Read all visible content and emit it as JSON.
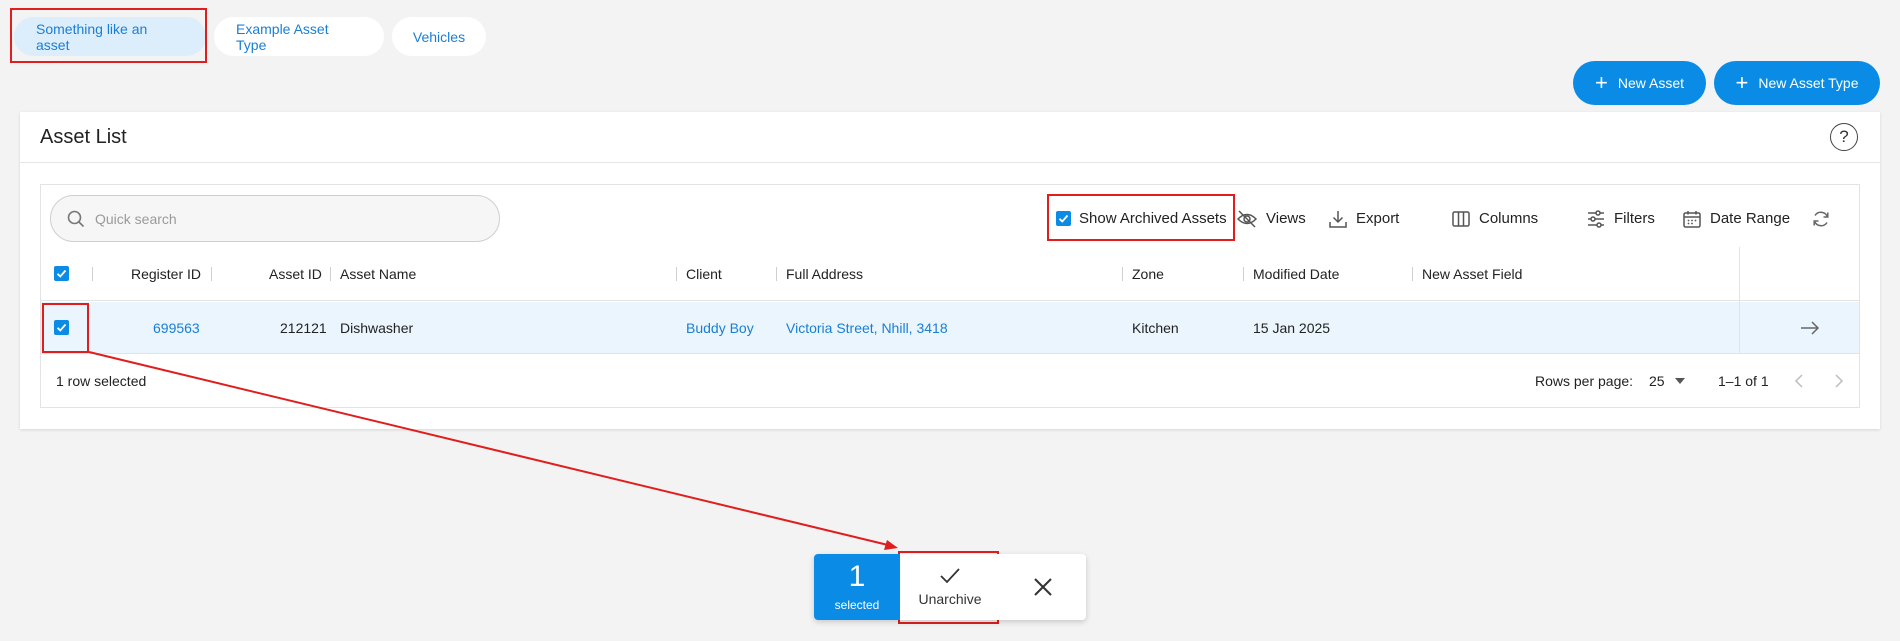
{
  "tabs": [
    {
      "label": "Something like an asset",
      "active": true
    },
    {
      "label": "Example Asset Type",
      "active": false
    },
    {
      "label": "Vehicles",
      "active": false
    }
  ],
  "actions": {
    "new_asset": "New Asset",
    "new_asset_type": "New Asset Type"
  },
  "card": {
    "title": "Asset List",
    "help_icon": "question-mark-circle"
  },
  "search": {
    "placeholder": "Quick search",
    "value": ""
  },
  "toolbar": {
    "show_archived_label": "Show Archived Assets",
    "show_archived_checked": true,
    "views": "Views",
    "export": "Export",
    "columns": "Columns",
    "filters": "Filters",
    "date_range": "Date Range"
  },
  "table": {
    "columns": [
      "Register ID",
      "Asset ID",
      "Asset Name",
      "Client",
      "Full Address",
      "Zone",
      "Modified Date",
      "New Asset Field"
    ],
    "rows": [
      {
        "selected": true,
        "register_id": "699563",
        "asset_id": "212121",
        "asset_name": "Dishwasher",
        "client": "Buddy Boy",
        "full_address": "Victoria Street, Nhill, 3418",
        "zone": "Kitchen",
        "modified_date": "15 Jan 2025",
        "new_asset_field": ""
      }
    ]
  },
  "footer": {
    "selection": "1 row selected",
    "rows_per_page_label": "Rows per page:",
    "rows_per_page": "25",
    "range": "1–1 of 1"
  },
  "selection_bar": {
    "count": "1",
    "count_label": "selected",
    "unarchive": "Unarchive"
  },
  "colors": {
    "accent": "#0a8be6",
    "link": "#1a7fd4",
    "highlight": "#e01e1e",
    "selected_row": "#eaf5fd"
  }
}
